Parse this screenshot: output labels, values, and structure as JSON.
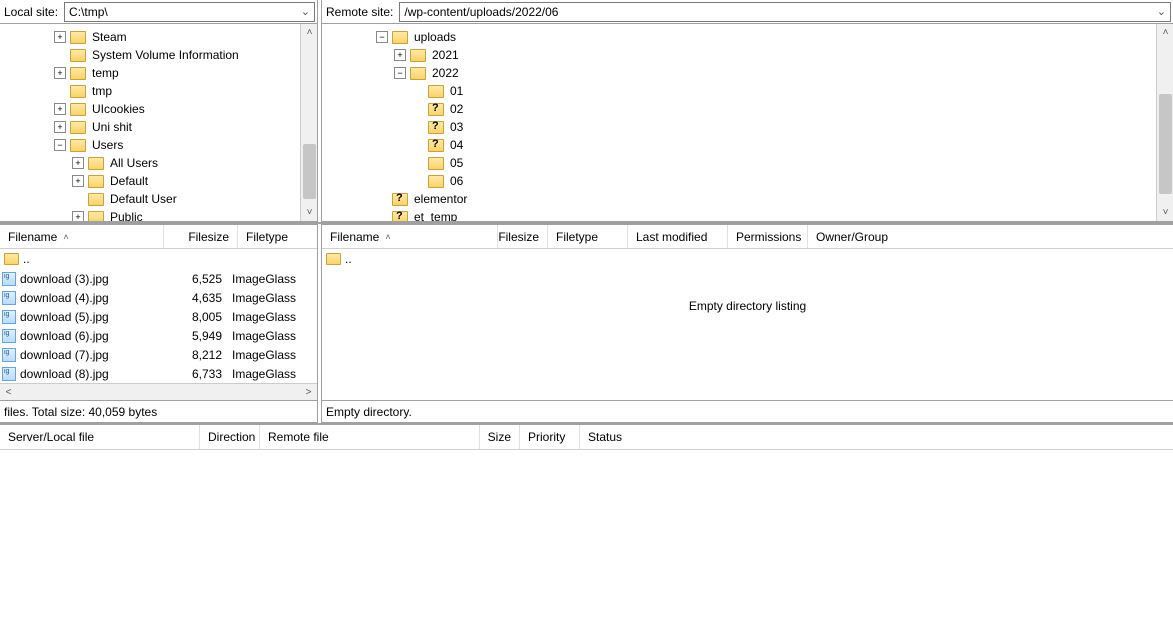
{
  "local": {
    "label": "Local site:",
    "path": "C:\\tmp\\",
    "tree": [
      {
        "indent": 3,
        "twisty": "+",
        "label": "Steam"
      },
      {
        "indent": 3,
        "twisty": "",
        "label": "System Volume Information"
      },
      {
        "indent": 3,
        "twisty": "+",
        "label": "temp"
      },
      {
        "indent": 3,
        "twisty": "",
        "label": "tmp"
      },
      {
        "indent": 3,
        "twisty": "+",
        "label": "UIcookies"
      },
      {
        "indent": 3,
        "twisty": "+",
        "label": "Uni shit"
      },
      {
        "indent": 3,
        "twisty": "-",
        "label": "Users"
      },
      {
        "indent": 4,
        "twisty": "+",
        "label": "All Users"
      },
      {
        "indent": 4,
        "twisty": "+",
        "label": "Default"
      },
      {
        "indent": 4,
        "twisty": "",
        "label": "Default User"
      },
      {
        "indent": 4,
        "twisty": "+",
        "label": "Public"
      }
    ],
    "columns": {
      "filename": "Filename",
      "filesize": "Filesize",
      "filetype": "Filetype"
    },
    "parent": "..",
    "files": [
      {
        "name": "download (3).jpg",
        "size": "6,525",
        "type": "ImageGlass"
      },
      {
        "name": "download (4).jpg",
        "size": "4,635",
        "type": "ImageGlass"
      },
      {
        "name": "download (5).jpg",
        "size": "8,005",
        "type": "ImageGlass"
      },
      {
        "name": "download (6).jpg",
        "size": "5,949",
        "type": "ImageGlass"
      },
      {
        "name": "download (7).jpg",
        "size": "8,212",
        "type": "ImageGlass"
      },
      {
        "name": "download (8).jpg",
        "size": "6,733",
        "type": "ImageGlass"
      }
    ],
    "status": "files. Total size: 40,059 bytes"
  },
  "remote": {
    "label": "Remote site:",
    "path": "/wp-content/uploads/2022/06",
    "tree": [
      {
        "indent": 3,
        "twisty": "-",
        "label": "uploads",
        "q": false
      },
      {
        "indent": 4,
        "twisty": "+",
        "label": "2021",
        "q": false
      },
      {
        "indent": 4,
        "twisty": "-",
        "label": "2022",
        "q": false
      },
      {
        "indent": 5,
        "twisty": "",
        "label": "01",
        "q": false
      },
      {
        "indent": 5,
        "twisty": "",
        "label": "02",
        "q": true
      },
      {
        "indent": 5,
        "twisty": "",
        "label": "03",
        "q": true
      },
      {
        "indent": 5,
        "twisty": "",
        "label": "04",
        "q": true
      },
      {
        "indent": 5,
        "twisty": "",
        "label": "05",
        "q": false
      },
      {
        "indent": 5,
        "twisty": "",
        "label": "06",
        "q": false
      },
      {
        "indent": 3,
        "twisty": "",
        "label": "elementor",
        "q": true
      },
      {
        "indent": 3,
        "twisty": "",
        "label": "et_temp",
        "q": true
      }
    ],
    "columns": {
      "filename": "Filename",
      "filesize": "Filesize",
      "filetype": "Filetype",
      "lastmod": "Last modified",
      "perms": "Permissions",
      "owner": "Owner/Group"
    },
    "parent": "..",
    "empty": "Empty directory listing",
    "status": "Empty directory."
  },
  "queue": {
    "columns": {
      "server": "Server/Local file",
      "direction": "Direction",
      "remote": "Remote file",
      "size": "Size",
      "priority": "Priority",
      "status": "Status"
    }
  }
}
